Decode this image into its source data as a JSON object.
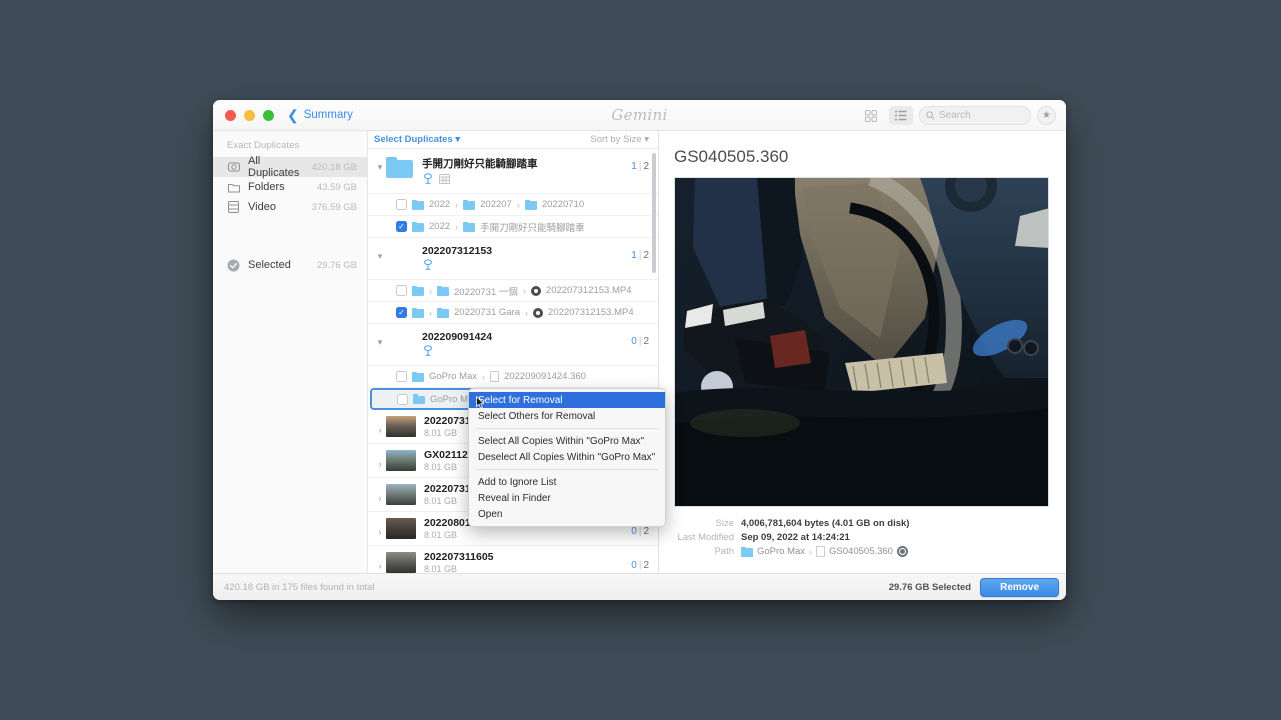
{
  "app": {
    "brand": "Gemini",
    "back_label": "Summary"
  },
  "toolbar": {
    "grid_view_icon": "grid-view-icon",
    "list_view_icon": "list-view-icon",
    "search_placeholder": "Search",
    "star_icon": "star-icon"
  },
  "sidebar": {
    "header": "Exact Duplicates",
    "items": [
      {
        "label": "All Duplicates",
        "size": "420.18 GB",
        "icon": "disk-icon",
        "selected": true
      },
      {
        "label": "Folders",
        "size": "43.59 GB",
        "icon": "folder-icon",
        "selected": false
      },
      {
        "label": "Video",
        "size": "376.59 GB",
        "icon": "film-icon",
        "selected": false
      }
    ],
    "selected_item": {
      "label": "Selected",
      "size": "29.76 GB",
      "icon": "check-circle-icon"
    }
  },
  "list_header": {
    "select_duplicates": "Select Duplicates",
    "sort_by": "Sort by Size"
  },
  "groups": [
    {
      "type": "folder",
      "title": "手開刀剛好只能騎腳踏車",
      "selected_count": "1",
      "total_count": "2",
      "badges": [
        "tag-icon",
        "calendar-icon"
      ],
      "children": [
        {
          "checked": false,
          "parts": [
            "2022",
            "202207",
            "20220710"
          ],
          "kinds": [
            "folder",
            "folder",
            "folder"
          ]
        },
        {
          "checked": true,
          "parts": [
            "2022",
            "手開刀剛好只能騎腳踏車"
          ],
          "kinds": [
            "folder",
            "folder"
          ]
        }
      ]
    },
    {
      "type": "video",
      "title": "202207312153",
      "selected_count": "1",
      "total_count": "2",
      "badges": [
        "tag-icon"
      ],
      "children": [
        {
          "checked": false,
          "parts": [
            "",
            "20220731 一個",
            "202207312153.MP4"
          ],
          "kinds": [
            "folder",
            "folder",
            "movie"
          ]
        },
        {
          "checked": true,
          "parts": [
            "",
            "20220731 Gara",
            "202207312153.MP4"
          ],
          "kinds": [
            "folder",
            "folder",
            "movie"
          ]
        }
      ]
    },
    {
      "type": "video",
      "title": "202209091424",
      "selected_count": "0",
      "total_count": "2",
      "badges": [
        "tag-icon"
      ],
      "children": [
        {
          "checked": false,
          "parts": [
            "GoPro Max",
            "202209091424.360"
          ],
          "kinds": [
            "folder",
            "doc"
          ]
        },
        {
          "checked": false,
          "parts": [
            "GoPro M"
          ],
          "kinds": [
            "folder"
          ],
          "highlighted": true
        }
      ]
    }
  ],
  "file_rows": [
    {
      "title": "202207311",
      "size": "8.01 GB",
      "selected_count": "",
      "total_count": ""
    },
    {
      "title": "GX021125",
      "size": "8.01 GB",
      "selected_count": "",
      "total_count": ""
    },
    {
      "title": "202207311",
      "size": "8.01 GB",
      "selected_count": "",
      "total_count": ""
    },
    {
      "title": "202208010021",
      "size": "8.01 GB",
      "selected_count": "0",
      "total_count": "2"
    },
    {
      "title": "202207311605",
      "size": "8.01 GB",
      "selected_count": "0",
      "total_count": "2"
    }
  ],
  "context_menu": {
    "items": [
      {
        "label": "Select for Removal",
        "selected": true
      },
      {
        "label": "Select Others for Removal",
        "selected": false
      },
      {
        "separator": true
      },
      {
        "label": "Select All Copies Within \"GoPro Max\"",
        "selected": false
      },
      {
        "label": "Deselect All Copies Within \"GoPro Max\"",
        "selected": false
      },
      {
        "separator": true
      },
      {
        "label": "Add to Ignore List",
        "selected": false
      },
      {
        "label": "Reveal in Finder",
        "selected": false
      },
      {
        "label": "Open",
        "selected": false
      }
    ]
  },
  "detail": {
    "title": "GS040505.360",
    "meta": [
      {
        "label": "Size",
        "value": "4,006,781,604 bytes (4.01 GB on disk)"
      },
      {
        "label": "Last Modified",
        "value": "Sep 09, 2022 at 14:24:21"
      }
    ],
    "path_label": "Path",
    "path_folder": "GoPro Max",
    "path_file": "GS040505.360"
  },
  "footer": {
    "status": "420.18 GB in 175 files found in total",
    "selected_size": "29.76 GB Selected",
    "remove_label": "Remove"
  },
  "colors": {
    "accent_blue": "#3b8ae8",
    "menu_highlight": "#2f6fdb",
    "desktop_bg": "#3f4c57"
  }
}
